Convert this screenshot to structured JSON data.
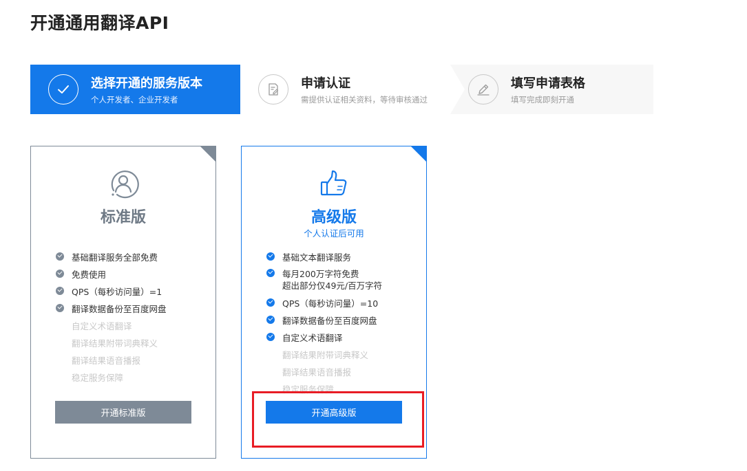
{
  "page": {
    "title": "开通通用翻译API"
  },
  "steps": [
    {
      "title": "选择开通的服务版本",
      "subtitle": "个人开发者、企业开发者",
      "state": "active",
      "icon": "check-icon"
    },
    {
      "title": "申请认证",
      "subtitle": "需提供认证相关资料，等待审核通过",
      "state": "pending",
      "icon": "document-edit-icon"
    },
    {
      "title": "填写申请表格",
      "subtitle": "填写完成即刻开通",
      "state": "pending",
      "icon": "pencil-icon"
    }
  ],
  "cards": {
    "standard": {
      "icon": "user-icon",
      "name": "标准版",
      "button_label": "开通标准版",
      "features_on": [
        "基础翻译服务全部免费",
        "免费使用",
        "QPS（每秒访问量）=1",
        "翻译数据备份至百度网盘"
      ],
      "features_off": [
        "自定义术语翻译",
        "翻译结果附带词典释义",
        "翻译结果语音播报",
        "稳定服务保障"
      ]
    },
    "premium": {
      "icon": "thumbs-up-icon",
      "name": "高级版",
      "note": "个人认证后可用",
      "button_label": "开通高级版",
      "features_on": [
        "基础文本翻译服务",
        "每月200万字符免费",
        "超出部分仅49元/百万字符",
        "QPS（每秒访问量）=10",
        "翻译数据备份至百度网盘",
        "自定义术语翻译"
      ],
      "features_off": [
        "翻译结果附带词典释义",
        "翻译结果语音播报",
        "稳定服务保障"
      ]
    }
  },
  "colors": {
    "accent": "#1479ea",
    "gray": "#7e8a97",
    "highlight": "#e81c24",
    "disabled_text": "#c8c8c8"
  }
}
